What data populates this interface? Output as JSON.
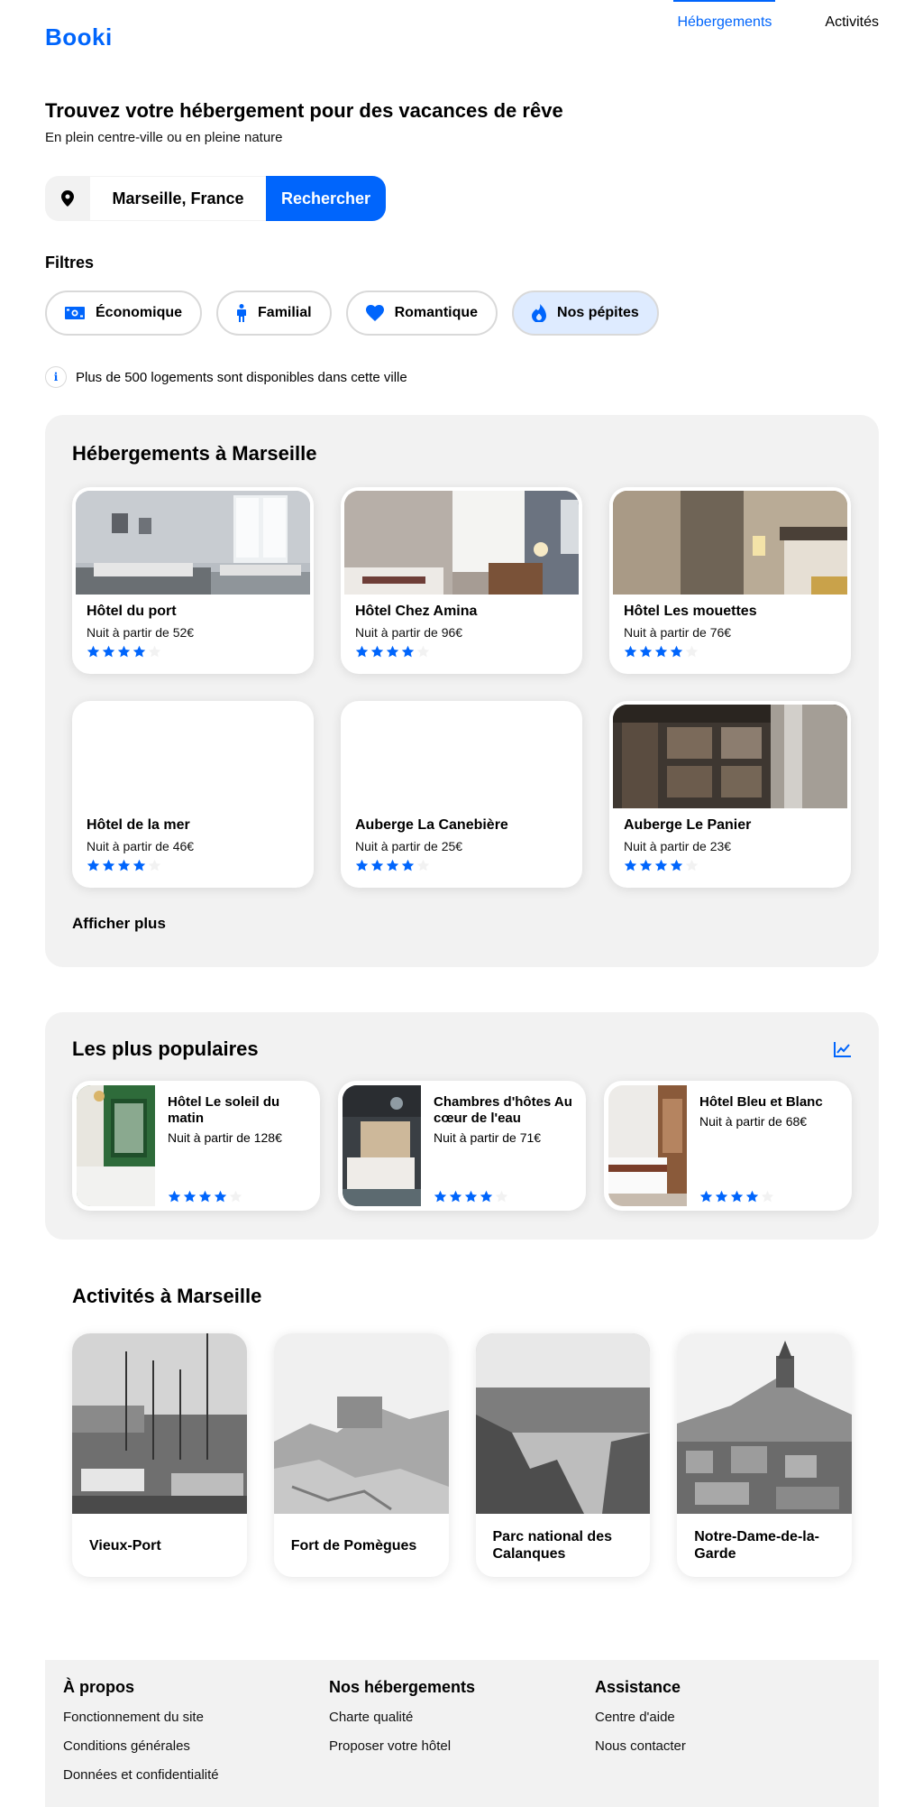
{
  "brand": {
    "logo": "Booki"
  },
  "nav": {
    "items": [
      "Hébergements",
      "Activités"
    ]
  },
  "hero": {
    "title": "Trouvez votre hébergement pour des vacances de rêve",
    "subtitle": "En plein centre-ville ou en pleine nature"
  },
  "search": {
    "value": "Marseille, France",
    "button": "Rechercher"
  },
  "filters": {
    "title": "Filtres",
    "items": [
      {
        "label": "Économique",
        "icon": "money-icon"
      },
      {
        "label": "Familial",
        "icon": "person-icon"
      },
      {
        "label": "Romantique",
        "icon": "heart-icon"
      },
      {
        "label": "Nos pépites",
        "icon": "fire-icon",
        "selected": true
      }
    ]
  },
  "info": {
    "text": "Plus de 500 logements sont disponibles dans cette ville"
  },
  "hotels": {
    "title": "Hébergements à Marseille",
    "items": [
      {
        "name": "Hôtel du port",
        "price": "Nuit à partir de 52€",
        "rating": 4
      },
      {
        "name": "Hôtel Chez Amina",
        "price": "Nuit à partir de 96€",
        "rating": 4
      },
      {
        "name": "Hôtel Les mouettes",
        "price": "Nuit à partir de 76€",
        "rating": 4
      },
      {
        "name": "Hôtel de la mer",
        "price": "Nuit à partir de 46€",
        "rating": 4
      },
      {
        "name": "Auberge La Canebière",
        "price": "Nuit à partir de 25€",
        "rating": 4
      },
      {
        "name": "Auberge Le Panier",
        "price": "Nuit à partir de 23€",
        "rating": 4
      }
    ],
    "more": "Afficher plus"
  },
  "popular": {
    "title": "Les plus populaires",
    "items": [
      {
        "name": "Hôtel Le soleil du matin",
        "price": "Nuit à partir de 128€",
        "rating": 4
      },
      {
        "name": "Chambres d'hôtes Au cœur de l'eau",
        "price": "Nuit à partir de 71€",
        "rating": 4
      },
      {
        "name": "Hôtel Bleu et Blanc",
        "price": "Nuit à partir de 68€",
        "rating": 4
      }
    ]
  },
  "activities": {
    "title": "Activités à Marseille",
    "items": [
      {
        "name": "Vieux-Port"
      },
      {
        "name": "Fort de Pomègues"
      },
      {
        "name": "Parc national des Calanques"
      },
      {
        "name": "Notre-Dame-de-la-Garde"
      }
    ]
  },
  "footer": {
    "columns": [
      {
        "title": "À propos",
        "links": [
          "Fonctionnement du site",
          "Conditions générales",
          "Données et confidentialité"
        ]
      },
      {
        "title": "Nos hébergements",
        "links": [
          "Charte qualité",
          "Proposer votre hôtel"
        ]
      },
      {
        "title": "Assistance",
        "links": [
          "Centre d'aide",
          "Nous contacter"
        ]
      }
    ]
  },
  "colors": {
    "primary": "#0065FC",
    "light_blue": "#DEEBFF",
    "grey_bg": "#F2F2F2",
    "star_empty": "#F2F2F2"
  }
}
